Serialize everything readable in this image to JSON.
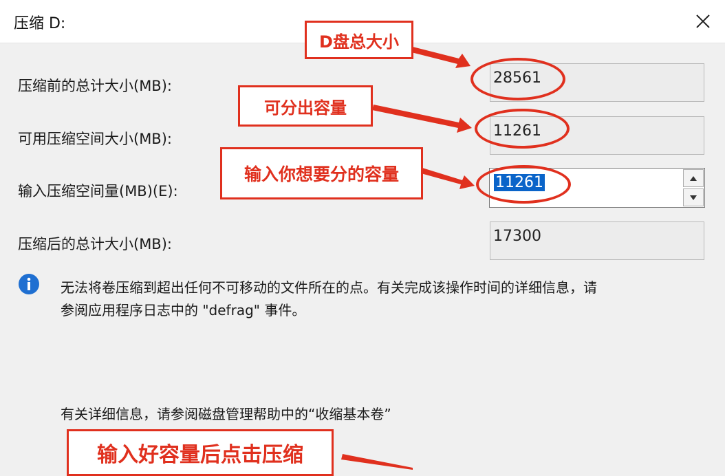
{
  "window": {
    "title": "压缩 D:"
  },
  "fields": {
    "total_before": {
      "label": "压缩前的总计大小(MB):",
      "value": "28561"
    },
    "available": {
      "label": "可用压缩空间大小(MB):",
      "value": "11261"
    },
    "shrink_amount": {
      "label": "输入压缩空间量(MB)(E):",
      "value": "11261"
    },
    "total_after": {
      "label": "压缩后的总计大小(MB):",
      "value": "17300"
    }
  },
  "info": {
    "line1": "无法将卷压缩到超出任何不可移动的文件所在的点。有关完成该操作时间的详细信息，请",
    "line2": "参阅应用程序日志中的 \"defrag\" 事件。"
  },
  "help": {
    "text": "有关详细信息，请参阅磁盘管理帮助中的“收缩基本卷”"
  },
  "annotations": {
    "disk_size": "D盘总大小",
    "available_capacity": "可分出容量",
    "enter_capacity": "输入你想要分的容量",
    "click_shrink": "输入好容量后点击压缩"
  },
  "colors": {
    "annotation": "#e0301e",
    "selection": "#0a64c9",
    "info_icon": "#1f6fd1"
  }
}
